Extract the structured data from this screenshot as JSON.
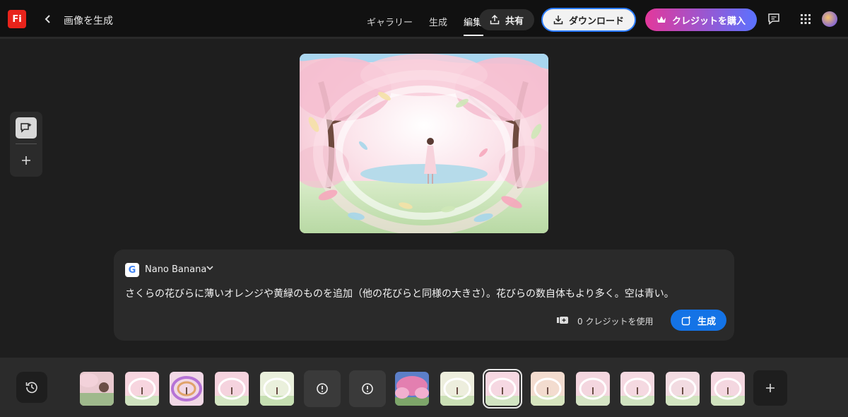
{
  "app": {
    "logo_text": "Fi",
    "title": "画像を生成"
  },
  "nav": {
    "tabs": [
      {
        "label": "ギャラリー"
      },
      {
        "label": "生成"
      },
      {
        "label": "編集",
        "active": true
      }
    ]
  },
  "header": {
    "share_label": "共有",
    "download_label": "ダウンロード",
    "buy_label": "クレジットを購入",
    "feedback_icon": "chat-bubble-icon",
    "apps_icon": "grid-icon"
  },
  "prompt": {
    "model_badge": "G",
    "model_name": "Nano Banana",
    "text": "さくらの花びらに薄いオレンジや黄緑のものを追加（他の花びらと同様の大きさ）。花びらの数自体もより多く。空は青い。",
    "credits_text": "0 クレジットを使用",
    "generate_label": "生成"
  },
  "colors": {
    "accent": "#1473e6",
    "logo": "#e8231b",
    "buy_gradient_start": "#e3389b",
    "buy_gradient_end": "#5a72ff"
  }
}
